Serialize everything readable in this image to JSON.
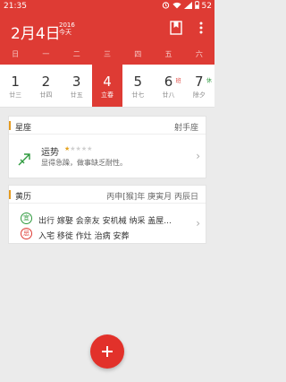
{
  "status": {
    "time": "21:35",
    "battery": "52"
  },
  "header": {
    "date": "2月4日",
    "year": "2016",
    "today_label": "今天"
  },
  "weekdays": [
    "日",
    "一",
    "二",
    "三",
    "四",
    "五",
    "六"
  ],
  "week": [
    {
      "num": "1",
      "lunar": "廿三"
    },
    {
      "num": "2",
      "lunar": "廿四"
    },
    {
      "num": "3",
      "lunar": "廿五"
    },
    {
      "num": "4",
      "lunar": "立春"
    },
    {
      "num": "5",
      "lunar": "廿七"
    },
    {
      "num": "6",
      "lunar": "廿八",
      "badge": "班"
    },
    {
      "num": "7",
      "lunar": "除夕",
      "badge": "休"
    }
  ],
  "horoscope": {
    "section_title": "星座",
    "sign": "射手座",
    "fortune_title": "运势",
    "stars_filled": 1,
    "stars_total": 5,
    "description": "显得急躁，做事缺乏耐性。"
  },
  "almanac": {
    "section_title": "黄历",
    "ganzhi": "丙申[猴]年 庚寅月 丙辰日",
    "yi_label": "宜",
    "yi_text": "出行 嫁娶 会亲友 安机械 纳采 盖屋...",
    "ji_label": "忌",
    "ji_text": "入宅 移徙 作灶 治病 安葬"
  },
  "colors": {
    "brand": "#de3b34",
    "accent": "#e5a31e",
    "good": "#2e9a3e"
  }
}
